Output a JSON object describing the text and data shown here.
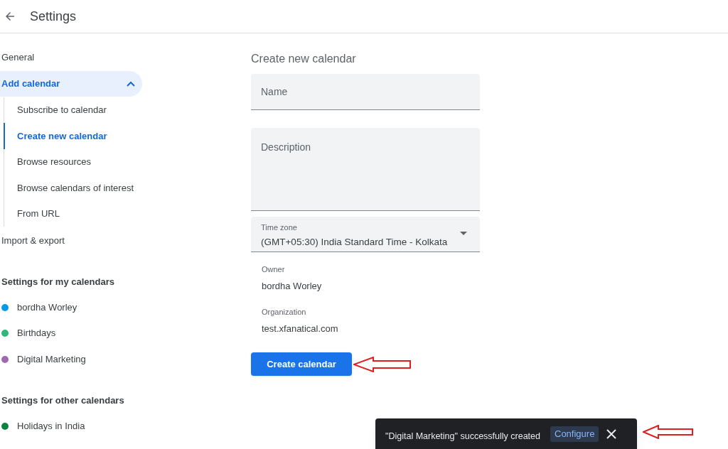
{
  "header": {
    "title": "Settings"
  },
  "sidebar": {
    "items": [
      {
        "label": "General",
        "selected": false
      },
      {
        "label": "Add calendar",
        "selected": true,
        "expanded": true,
        "children": [
          {
            "label": "Subscribe to calendar",
            "selected": false
          },
          {
            "label": "Create new calendar",
            "selected": true
          },
          {
            "label": "Browse resources",
            "selected": false
          },
          {
            "label": "Browse calendars of interest",
            "selected": false
          },
          {
            "label": "From URL",
            "selected": false
          }
        ]
      },
      {
        "label": "Import & export",
        "selected": false
      }
    ],
    "sections": [
      {
        "heading": "Settings for my calendars",
        "calendars": [
          {
            "name": "bordha Worley",
            "color": "#039be5"
          },
          {
            "name": "Birthdays",
            "color": "#33b679"
          },
          {
            "name": "Digital Marketing",
            "color": "#9e69af"
          }
        ]
      },
      {
        "heading": "Settings for other calendars",
        "calendars": [
          {
            "name": "Holidays in India",
            "color": "#0b8043"
          }
        ]
      }
    ]
  },
  "form": {
    "title": "Create new calendar",
    "name_field": {
      "placeholder": "Name"
    },
    "description_field": {
      "placeholder": "Description"
    },
    "time_zone": {
      "label": "Time zone",
      "value": "(GMT+05:30) India Standard Time - Kolkata"
    },
    "owner": {
      "label": "Owner",
      "value": "bordha Worley"
    },
    "organization": {
      "label": "Organization",
      "value": "test.xfanatical.com"
    },
    "submit_button": "Create calendar"
  },
  "snackbar": {
    "message": "\"Digital Marketing\" successfully created",
    "action": "Configure"
  }
}
